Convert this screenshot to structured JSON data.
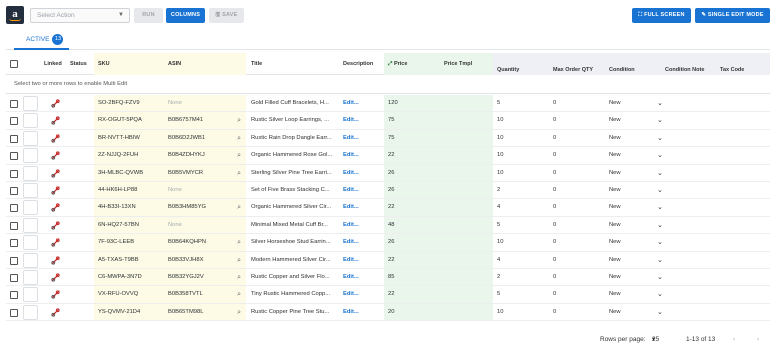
{
  "toolbar": {
    "logo_text": "a",
    "select_action_placeholder": "Select Action",
    "run_label": "RUN",
    "columns_label": "COLUMNS",
    "save_label": "SAVE",
    "full_screen_label": "FULL SCREEN",
    "single_edit_label": "SINGLE EDIT MODE"
  },
  "tabs": [
    {
      "label": "ACTIVE",
      "count": "13"
    }
  ],
  "table": {
    "columns": [
      "Linked",
      "Status",
      "SKU",
      "ASIN",
      "Title",
      "Description",
      "Price",
      "Price Tmpl",
      "Quantity",
      "Max Order QTY",
      "Condition",
      "Condition Note",
      "Tax Code"
    ],
    "multi_edit_message": "Select two or more rows to enable Multi Edit",
    "rows": [
      {
        "sku": "SO-2BFQ-FZV9",
        "asin": "None",
        "title": "Gold Filled Cuff Bracelets, H...",
        "description": "Edit...",
        "price": "120",
        "quantity": "5",
        "max_qty": "0",
        "condition": "New"
      },
      {
        "sku": "RX-OGUT-5PQA",
        "asin": "B0B6757M41",
        "title": "Rustic Silver Loop Earrings, ...",
        "description": "Edit...",
        "price": "75",
        "quantity": "10",
        "max_qty": "0",
        "condition": "New"
      },
      {
        "sku": "BR-NVTT-HBIW",
        "asin": "B0B6D2JWB1",
        "title": "Rustic Rain Drop Dangle Earr...",
        "description": "Edit...",
        "price": "75",
        "quantity": "10",
        "max_qty": "0",
        "condition": "New"
      },
      {
        "sku": "2Z-NJJQ-2FUH",
        "asin": "B0B4ZDHYKJ",
        "title": "Organic Hammered Rose Gol...",
        "description": "Edit...",
        "price": "22",
        "quantity": "10",
        "max_qty": "0",
        "condition": "New"
      },
      {
        "sku": "3H-MLBC-QVWB",
        "asin": "B0B5VMYCR",
        "title": "Sterling Silver Pine Tree Earri...",
        "description": "Edit...",
        "price": "26",
        "quantity": "10",
        "max_qty": "0",
        "condition": "New"
      },
      {
        "sku": "44-HK6H-LP88",
        "asin": "None",
        "title": "Set of Five Brass Stacking C...",
        "description": "Edit...",
        "price": "26",
        "quantity": "2",
        "max_qty": "0",
        "condition": "New"
      },
      {
        "sku": "4H-B33I-13XN",
        "asin": "B0B3HM85YG",
        "title": "Organic Hammered Silver Cir...",
        "description": "Edit...",
        "price": "22",
        "quantity": "4",
        "max_qty": "0",
        "condition": "New"
      },
      {
        "sku": "6N-HQ27-57BN",
        "asin": "None",
        "title": "Minimal Mixed Metal Cuff Br...",
        "description": "Edit...",
        "price": "48",
        "quantity": "5",
        "max_qty": "0",
        "condition": "New"
      },
      {
        "sku": "7F-93C-LEEB",
        "asin": "B0B64KQHPN",
        "title": "Silver Horseshoe Stud Earrin...",
        "description": "Edit...",
        "price": "26",
        "quantity": "10",
        "max_qty": "0",
        "condition": "New"
      },
      {
        "sku": "A5-TXAS-T9BB",
        "asin": "B0B33VJH8X",
        "title": "Modern Hammered Silver Cir...",
        "description": "Edit...",
        "price": "22",
        "quantity": "4",
        "max_qty": "0",
        "condition": "New"
      },
      {
        "sku": "C6-MWPA-3N7D",
        "asin": "B0B32YGJ2V",
        "title": "Rustic Copper and Silver Flo...",
        "description": "Edit...",
        "price": "85",
        "quantity": "2",
        "max_qty": "0",
        "condition": "New"
      },
      {
        "sku": "VX-RFU-OVVQ",
        "asin": "B0B358TVTL",
        "title": "Tiny Rustic Hammered Copp...",
        "description": "Edit...",
        "price": "22",
        "quantity": "5",
        "max_qty": "0",
        "condition": "New"
      },
      {
        "sku": "YS-QVMV-21D4",
        "asin": "B0B65TM98L",
        "title": "Rustic Copper Pine Tree Stu...",
        "description": "Edit...",
        "price": "20",
        "quantity": "10",
        "max_qty": "0",
        "condition": "New"
      }
    ]
  },
  "pagination": {
    "rows_per_page_label": "Rows per page:",
    "rows_per_page_value": "25",
    "range_text": "1-13 of 13"
  },
  "colors": {
    "accent": "#1973d2",
    "yellow_col": "#fdfbe6",
    "green_col": "#eaf6ec",
    "blue_col": "#eef0f6",
    "link_red": "#c62828"
  }
}
